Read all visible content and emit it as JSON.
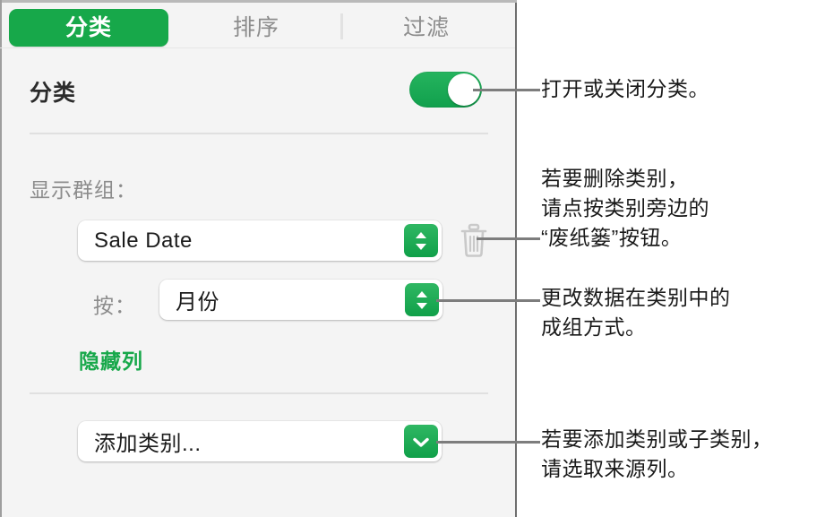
{
  "panel": {
    "tabs": [
      {
        "label": "分类",
        "active": true
      },
      {
        "label": "排序",
        "active": false
      },
      {
        "label": "过滤",
        "active": false
      }
    ],
    "section": {
      "title": "分类",
      "toggle_state": "on"
    },
    "show_groups_label": "显示群组：",
    "category_popup": {
      "value": "Sale Date",
      "button_icon": "stepper-updown-icon"
    },
    "trash_icon": "trash-icon",
    "by_label": "按：",
    "by_popup": {
      "value": "月份",
      "button_icon": "stepper-updown-icon"
    },
    "hide_column_link": "隐藏列",
    "add_category_popup": {
      "value": "添加类别...",
      "button_icon": "chevron-down-icon"
    }
  },
  "callouts": [
    {
      "text": "打开或关闭分类。"
    },
    {
      "text": "若要删除类别，\n请点按类别旁边的\n“废纸篓”按钮。"
    },
    {
      "text": "更改数据在类别中的\n成组方式。"
    },
    {
      "text": "若要添加类别或子类别，\n请选取来源列。"
    }
  ],
  "colors": {
    "accent_green": "#17a84a",
    "panel_background": "#f4f4f4",
    "label_gray": "#8c8c8c",
    "divider_gray": "#e0e0e0",
    "leader_gray": "#7d7d7d"
  }
}
